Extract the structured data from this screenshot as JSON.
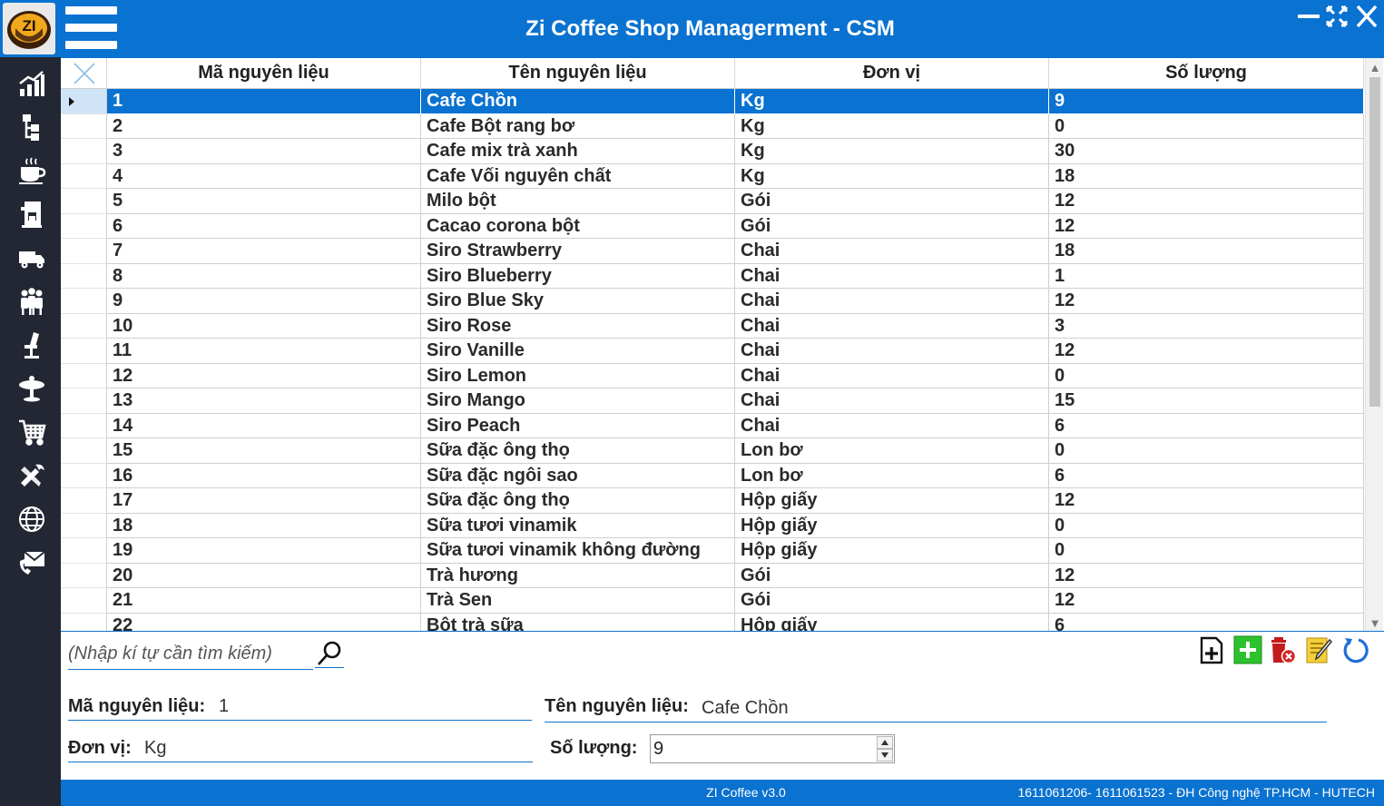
{
  "window": {
    "title": "Zi Coffee Shop Managerment - CSM",
    "logo_text": "ZI",
    "controls": [
      "minimize-icon",
      "restore-icon",
      "close-icon"
    ]
  },
  "colors": {
    "accent": "#0a72d0",
    "sidebar": "#232733",
    "selected_row": "#0a72d0",
    "selected_row_header": "#cfe4f7"
  },
  "sidebar": {
    "items": [
      {
        "icon": "chart-icon"
      },
      {
        "icon": "hierarchy-icon"
      },
      {
        "icon": "coffee-cup-icon"
      },
      {
        "icon": "coffee-machine-icon"
      },
      {
        "icon": "delivery-truck-icon"
      },
      {
        "icon": "staff-group-icon"
      },
      {
        "icon": "chair-icon"
      },
      {
        "icon": "table-icon"
      },
      {
        "icon": "shopping-cart-icon"
      },
      {
        "icon": "tools-icon"
      },
      {
        "icon": "globe-icon"
      },
      {
        "icon": "mail-phone-icon"
      }
    ]
  },
  "grid": {
    "columns": [
      "Mã nguyên liệu",
      "Tên nguyên liệu",
      "Đơn vị",
      "Số lượng"
    ],
    "selected_index": 0,
    "rows": [
      {
        "id": "1",
        "name": "Cafe Chồn",
        "unit": "Kg",
        "qty": "9"
      },
      {
        "id": "2",
        "name": "Cafe Bột rang bơ",
        "unit": "Kg",
        "qty": "0"
      },
      {
        "id": "3",
        "name": "Cafe mix trà xanh",
        "unit": "Kg",
        "qty": "30"
      },
      {
        "id": "4",
        "name": "Cafe Vối nguyên chất",
        "unit": "Kg",
        "qty": "18"
      },
      {
        "id": "5",
        "name": "Milo bột",
        "unit": "Gói",
        "qty": "12"
      },
      {
        "id": "6",
        "name": "Cacao corona bột",
        "unit": "Gói",
        "qty": "12"
      },
      {
        "id": "7",
        "name": "Siro Strawberry",
        "unit": "Chai",
        "qty": "18"
      },
      {
        "id": "8",
        "name": "Siro Blueberry",
        "unit": "Chai",
        "qty": "1"
      },
      {
        "id": "9",
        "name": "Siro Blue Sky",
        "unit": "Chai",
        "qty": "12"
      },
      {
        "id": "10",
        "name": "Siro Rose",
        "unit": "Chai",
        "qty": "3"
      },
      {
        "id": "11",
        "name": "Siro Vanille",
        "unit": "Chai",
        "qty": "12"
      },
      {
        "id": "12",
        "name": "Siro Lemon",
        "unit": "Chai",
        "qty": "0"
      },
      {
        "id": "13",
        "name": "Siro Mango",
        "unit": "Chai",
        "qty": "15"
      },
      {
        "id": "14",
        "name": "Siro Peach",
        "unit": "Chai",
        "qty": "6"
      },
      {
        "id": "15",
        "name": "Sữa đặc ông thọ",
        "unit": "Lon bơ",
        "qty": "0"
      },
      {
        "id": "16",
        "name": "Sữa đặc ngôi sao",
        "unit": "Lon bơ",
        "qty": "6"
      },
      {
        "id": "17",
        "name": "Sữa đặc ông thọ",
        "unit": "Hộp giấy",
        "qty": "12"
      },
      {
        "id": "18",
        "name": "Sữa tươi vinamik",
        "unit": "Hộp giấy",
        "qty": "0"
      },
      {
        "id": "19",
        "name": "Sữa tươi vinamik không đường",
        "unit": "Hộp giấy",
        "qty": "0"
      },
      {
        "id": "20",
        "name": "Trà hương",
        "unit": "Gói",
        "qty": "12"
      },
      {
        "id": "21",
        "name": "Trà Sen",
        "unit": "Gói",
        "qty": "12"
      },
      {
        "id": "22",
        "name": "Bột trà sữa",
        "unit": "Hộp giấy",
        "qty": "6"
      }
    ]
  },
  "search": {
    "placeholder": "(Nhập kí tự cần tìm kiếm)"
  },
  "toolbar": {
    "buttons": [
      "add-document-icon",
      "add-icon",
      "delete-icon",
      "edit-icon",
      "refresh-icon"
    ]
  },
  "form": {
    "id_label": "Mã nguyên liệu:",
    "id_value": "1",
    "name_label": "Tên nguyên liệu:",
    "name_value": "Cafe Chồn",
    "unit_label": "Đơn vị:",
    "unit_value": "Kg",
    "qty_label": "Số lượng:",
    "qty_value": "9"
  },
  "status": {
    "version": "ZI Coffee v3.0",
    "credits": "1611061206- 1611061523 - ĐH Công nghệ TP.HCM - HUTECH"
  }
}
